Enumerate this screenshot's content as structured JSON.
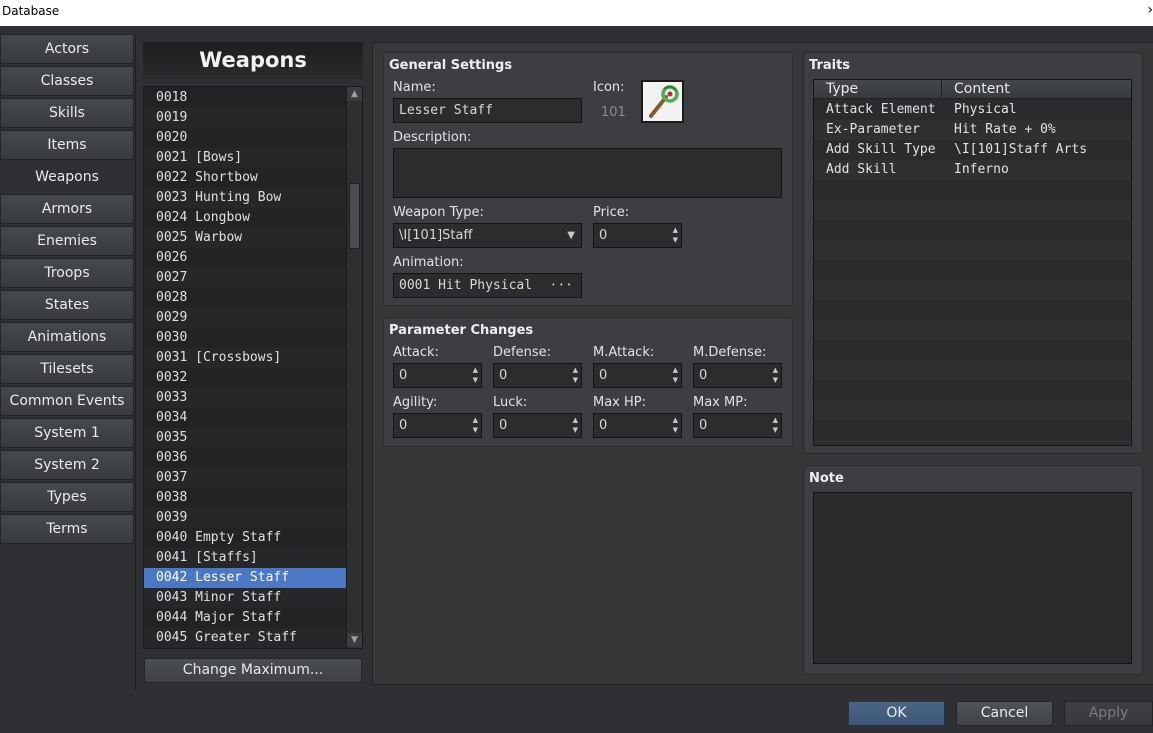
{
  "window": {
    "title": "Database",
    "close_glyph": "›"
  },
  "tabs": [
    "Actors",
    "Classes",
    "Skills",
    "Items",
    "Weapons",
    "Armors",
    "Enemies",
    "Troops",
    "States",
    "Animations",
    "Tilesets",
    "Common Events",
    "System 1",
    "System 2",
    "Types",
    "Terms"
  ],
  "active_tab": "Weapons",
  "list": {
    "header": "Weapons",
    "rows": [
      "0018",
      "0019",
      "0020",
      "0021 [Bows]",
      "0022 Shortbow",
      "0023 Hunting Bow",
      "0024 Longbow",
      "0025 Warbow",
      "0026",
      "0027",
      "0028",
      "0029",
      "0030",
      "0031 [Crossbows]",
      "0032",
      "0033",
      "0034",
      "0035",
      "0036",
      "0037",
      "0038",
      "0039",
      "0040 Empty Staff",
      "0041 [Staffs]",
      "0042 Lesser Staff",
      "0043 Minor Staff",
      "0044 Major Staff",
      "0045 Greater Staff"
    ],
    "selected_index": 24,
    "change_max_label": "Change Maximum..."
  },
  "general": {
    "title": "General Settings",
    "name_label": "Name:",
    "name_value": "Lesser Staff",
    "icon_label": "Icon:",
    "icon_index": "101",
    "description_label": "Description:",
    "description_value": "",
    "weapon_type_label": "Weapon Type:",
    "weapon_type_value": "\\I[101]Staff",
    "price_label": "Price:",
    "price_value": "0",
    "animation_label": "Animation:",
    "animation_value": "0001 Hit Physical",
    "animation_button": "···"
  },
  "params": {
    "title": "Parameter Changes",
    "items": [
      {
        "label": "Attack:",
        "value": "0"
      },
      {
        "label": "Defense:",
        "value": "0"
      },
      {
        "label": "M.Attack:",
        "value": "0"
      },
      {
        "label": "M.Defense:",
        "value": "0"
      },
      {
        "label": "Agility:",
        "value": "0"
      },
      {
        "label": "Luck:",
        "value": "0"
      },
      {
        "label": "Max HP:",
        "value": "0"
      },
      {
        "label": "Max MP:",
        "value": "0"
      }
    ]
  },
  "traits": {
    "title": "Traits",
    "col_type": "Type",
    "col_content": "Content",
    "rows": [
      {
        "type": "Attack Element",
        "content": "Physical"
      },
      {
        "type": "Ex-Parameter",
        "content": "Hit Rate + 0%"
      },
      {
        "type": "Add Skill Type",
        "content": "\\I[101]Staff Arts"
      },
      {
        "type": "Add Skill",
        "content": "Inferno"
      }
    ]
  },
  "note": {
    "title": "Note",
    "value": ""
  },
  "buttons": {
    "ok": "OK",
    "cancel": "Cancel",
    "apply": "Apply"
  },
  "colors": {
    "selection": "#4b77c4",
    "background": "#2e3033",
    "panel": "#3c3e41"
  },
  "icons": {
    "weapon_icon": "staff-icon"
  }
}
